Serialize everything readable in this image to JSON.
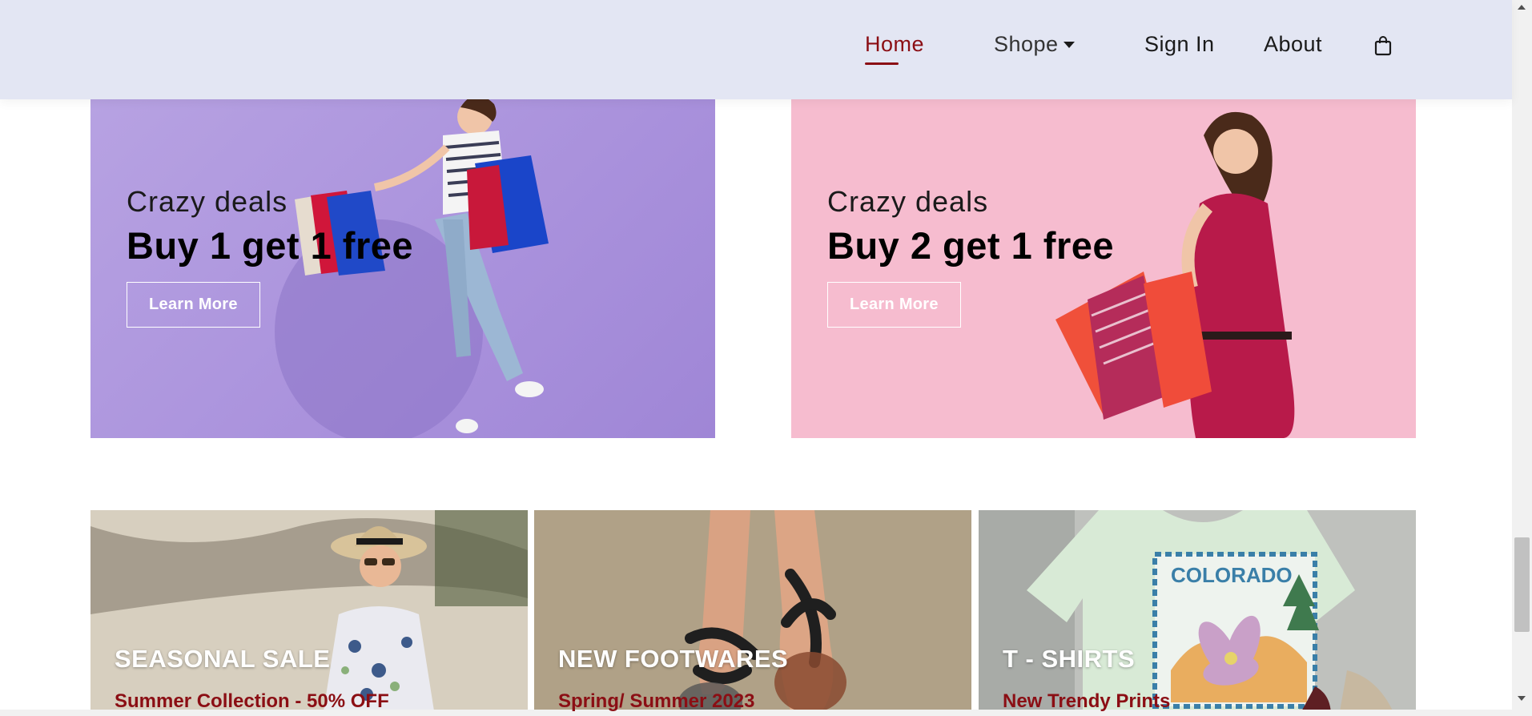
{
  "nav": {
    "items": [
      {
        "label": "Home",
        "active": true
      },
      {
        "label": "Shope",
        "has_dropdown": true
      },
      {
        "label": "Sign In"
      },
      {
        "label": "About"
      }
    ],
    "cart_icon": "shopping-bag-icon",
    "active_color": "#8b0e14",
    "background": "#e3e6f3"
  },
  "banners": [
    {
      "eyebrow": "Crazy deals",
      "headline": "Buy 1 get 1 free",
      "button": "Learn More",
      "background": "#b09ddf"
    },
    {
      "eyebrow": "Crazy deals",
      "headline": "Buy 2 get 1 free",
      "button": "Learn More",
      "background": "#f6bccf"
    }
  ],
  "categories": [
    {
      "title": "SEASONAL SALE",
      "subtitle": "Summer Collection - 50% OFF"
    },
    {
      "title": "NEW FOOTWARES",
      "subtitle": "Spring/ Summer 2023"
    },
    {
      "title": "T - SHIRTS",
      "subtitle": "New Trendy Prints"
    }
  ],
  "accent_color": "#8b0e14"
}
